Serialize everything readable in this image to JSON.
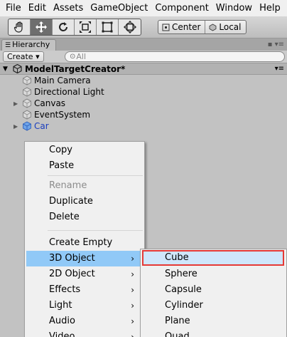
{
  "menubar": [
    "File",
    "Edit",
    "Assets",
    "GameObject",
    "Component",
    "Window",
    "Help"
  ],
  "toolbar": {
    "tools": [
      {
        "name": "hand-tool",
        "icon": "hand-icon"
      },
      {
        "name": "move-tool",
        "icon": "move-icon"
      },
      {
        "name": "rotate-tool",
        "icon": "rotate-icon"
      },
      {
        "name": "scale-tool",
        "icon": "scale-icon"
      },
      {
        "name": "rect-tool",
        "icon": "rect-icon"
      },
      {
        "name": "transform-tool",
        "icon": "transform-icon"
      }
    ],
    "active_tool": "move-tool",
    "pivot_label": "Center",
    "space_label": "Local"
  },
  "hierarchy": {
    "tab_label": "Hierarchy",
    "create_label": "Create",
    "search_placeholder": "All",
    "scene_name": "ModelTargetCreator*",
    "items": [
      {
        "label": "Main Camera",
        "expandable": false
      },
      {
        "label": "Directional Light",
        "expandable": false
      },
      {
        "label": "Canvas",
        "expandable": true
      },
      {
        "label": "EventSystem",
        "expandable": false
      },
      {
        "label": "Car",
        "expandable": true,
        "prefab": true
      }
    ]
  },
  "context_menu": {
    "items": [
      {
        "label": "Copy"
      },
      {
        "label": "Paste"
      },
      {
        "label": "Rename",
        "disabled": true
      },
      {
        "label": "Duplicate"
      },
      {
        "label": "Delete"
      },
      {
        "label": "Create Empty"
      },
      {
        "label": "3D Object",
        "submenu": true,
        "highlighted": true
      },
      {
        "label": "2D Object",
        "submenu": true
      },
      {
        "label": "Effects",
        "submenu": true
      },
      {
        "label": "Light",
        "submenu": true
      },
      {
        "label": "Audio",
        "submenu": true
      },
      {
        "label": "Video",
        "submenu": true
      }
    ]
  },
  "submenu_3d": {
    "items": [
      "Cube",
      "Sphere",
      "Capsule",
      "Cylinder",
      "Plane",
      "Quad"
    ],
    "selected": "Cube"
  },
  "colors": {
    "highlight": "#91c9f7",
    "selection_border": "#e53935",
    "prefab_text": "#1a3dbd"
  }
}
